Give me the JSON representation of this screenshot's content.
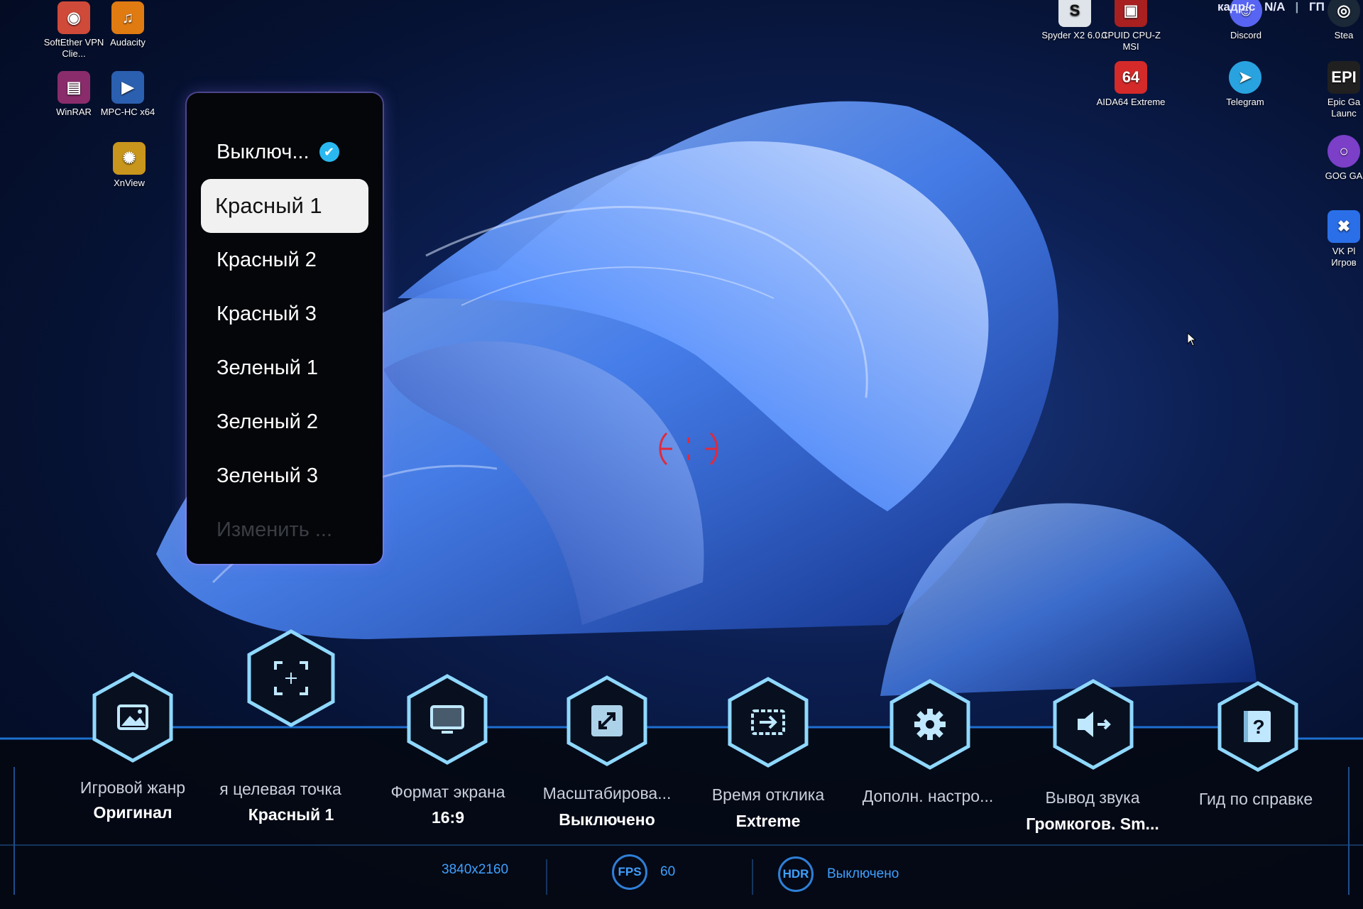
{
  "desktop": {
    "icons": [
      {
        "label": "SoftEther VPN Clie...",
        "icon": "softether-icon",
        "color": "#d04a3a"
      },
      {
        "label": "Audacity",
        "icon": "audacity-icon",
        "color": "#e07b12"
      },
      {
        "label": "WinRAR",
        "icon": "winrar-icon",
        "color": "#8a2c6c"
      },
      {
        "label": "MPC-HC x64",
        "icon": "mpc-hc-icon",
        "color": "#2b5fb0"
      },
      {
        "label": "XnView",
        "icon": "xnview-icon",
        "color": "#c8961c"
      },
      {
        "label": "Spyder X2 6.0.1",
        "icon": "spyder-icon",
        "color": "#dfe3ea"
      },
      {
        "label": "CPUID CPU-Z MSI",
        "icon": "cpu-z-icon",
        "color": "#a82020"
      },
      {
        "label": "Discord",
        "icon": "discord-icon",
        "color": "#5865f2"
      },
      {
        "label": "Stea",
        "icon": "steam-icon",
        "color": "#1b2838"
      },
      {
        "label": "AIDA64 Extreme",
        "icon": "aida64-icon",
        "color": "#d42a2a"
      },
      {
        "label": "Telegram",
        "icon": "telegram-icon",
        "color": "#29a3df"
      },
      {
        "label": "Epic Ga Launc",
        "icon": "epic-games-icon",
        "color": "#202020"
      },
      {
        "label": "GOG GA",
        "icon": "gog-galaxy-icon",
        "color": "#7b3fc8"
      },
      {
        "label": "VK Pl Игров",
        "icon": "vk-play-icon",
        "color": "#2a6fe8"
      }
    ],
    "top_status": {
      "left": "кадр/с",
      "value": "N/A",
      "right": "ГП"
    }
  },
  "crosshair_menu": {
    "items": [
      {
        "label": "Выключ...",
        "state": "checked"
      },
      {
        "label": "Красный 1",
        "state": "selected"
      },
      {
        "label": "Красный 2",
        "state": "normal"
      },
      {
        "label": "Красный 3",
        "state": "normal"
      },
      {
        "label": "Зеленый 1",
        "state": "normal"
      },
      {
        "label": "Зеленый 2",
        "state": "normal"
      },
      {
        "label": "Зеленый 3",
        "state": "normal"
      },
      {
        "label": "Изменить ...",
        "state": "disabled"
      }
    ],
    "check_color": "#2ab8f0"
  },
  "crosshair": {
    "color": "#e02a3c"
  },
  "bottom_menu": {
    "options": [
      {
        "label": "Игровой жанр",
        "value": "Оригинал",
        "icon": "image-icon"
      },
      {
        "label": "я целевая точка",
        "value": "Красный 1",
        "icon": "crosshair-target-icon"
      },
      {
        "label": "Формат экрана",
        "value": "16:9",
        "icon": "monitor-icon"
      },
      {
        "label": "Масштабирова...",
        "value": "Выключено",
        "icon": "expand-icon"
      },
      {
        "label": "Время отклика",
        "value": "Extreme",
        "icon": "response-time-icon"
      },
      {
        "label": "Дополн. настро...",
        "value": "",
        "icon": "gear-icon"
      },
      {
        "label": "Вывод звука",
        "value": "Громкогов. Sm...",
        "icon": "speaker-output-icon"
      },
      {
        "label": "Гид по справке",
        "value": "",
        "icon": "help-book-icon"
      }
    ],
    "resolution": "3840x2160",
    "fps_label": "FPS",
    "fps_value": "60",
    "hdr_label": "HDR",
    "hdr_value": "Выключено"
  },
  "colors": {
    "accent": "#3fa0ff",
    "hex_border": "#8fd8ff",
    "panel_line": "#1e6fd0"
  }
}
